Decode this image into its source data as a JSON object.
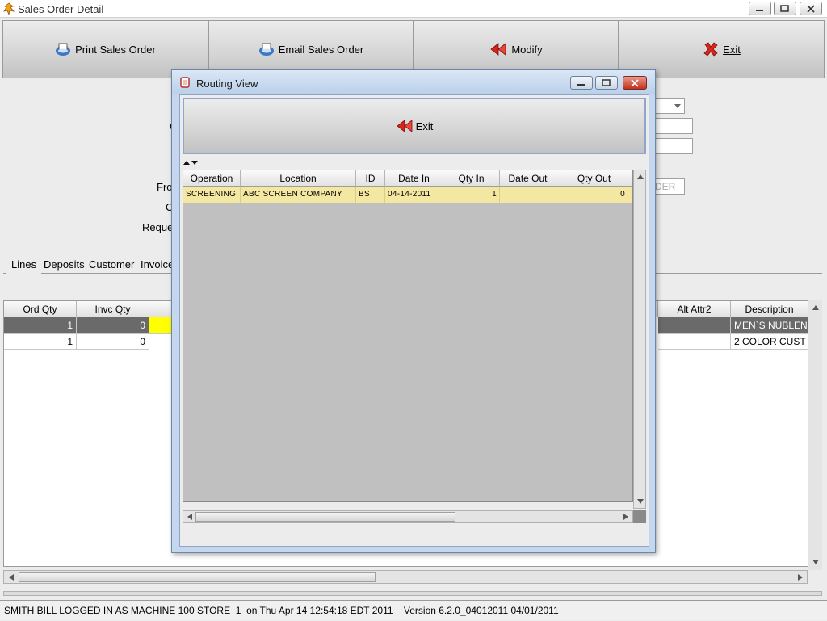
{
  "window": {
    "title": "Sales Order Detail"
  },
  "toolbar": {
    "print_label": "Print Sales Order",
    "email_label": "Email Sales Order",
    "modify_label": "Modify",
    "exit_label": "Exit"
  },
  "form": {
    "label_from": "Fro",
    "label_c": "C",
    "label_request": "Reque",
    "field_order_partial": "DER"
  },
  "tabs": [
    {
      "label": "Lines"
    },
    {
      "label": "Deposits"
    },
    {
      "label": "Customer"
    },
    {
      "label": "Invoice"
    }
  ],
  "lines_grid": {
    "headers": {
      "ord_qty": "Ord Qty",
      "invc_qty": "Invc Qty",
      "alt_attr2": "Alt Attr2",
      "description": "Description"
    },
    "rows": [
      {
        "ord_qty": "1",
        "invc_qty": "0",
        "description": "MEN`S NUBLEN"
      },
      {
        "ord_qty": "1",
        "invc_qty": "0",
        "description": "2 COLOR CUST"
      }
    ]
  },
  "dialog": {
    "title": "Routing View",
    "exit_label": "Exit",
    "headers": {
      "operation": "Operation",
      "location": "Location",
      "id": "ID",
      "date_in": "Date In",
      "qty_in": "Qty In",
      "date_out": "Date Out",
      "qty_out": "Qty Out"
    },
    "rows": [
      {
        "operation": "SCREENING",
        "location": "ABC SCREEN COMPANY",
        "id": "BS",
        "date_in": "04-14-2011",
        "qty_in": "1",
        "date_out": "",
        "qty_out": "0"
      }
    ]
  },
  "statusbar": {
    "text": "SMITH BILL LOGGED IN AS MACHINE 100 STORE  1  on Thu Apr 14 12:54:18 EDT 2011    Version 6.2.0_04012011 04/01/2011"
  },
  "colors": {
    "selected_row": "#f3e7a2",
    "highlight_cell": "#ffff00",
    "dark_row": "#6a6a6a",
    "dialog_frame": "#c4d7ee"
  },
  "icons": [
    "app-icon",
    "printer-icon",
    "email-printer-icon",
    "back-arrows-icon",
    "red-x-icon",
    "minimize-icon",
    "maximize-icon",
    "close-icon"
  ]
}
